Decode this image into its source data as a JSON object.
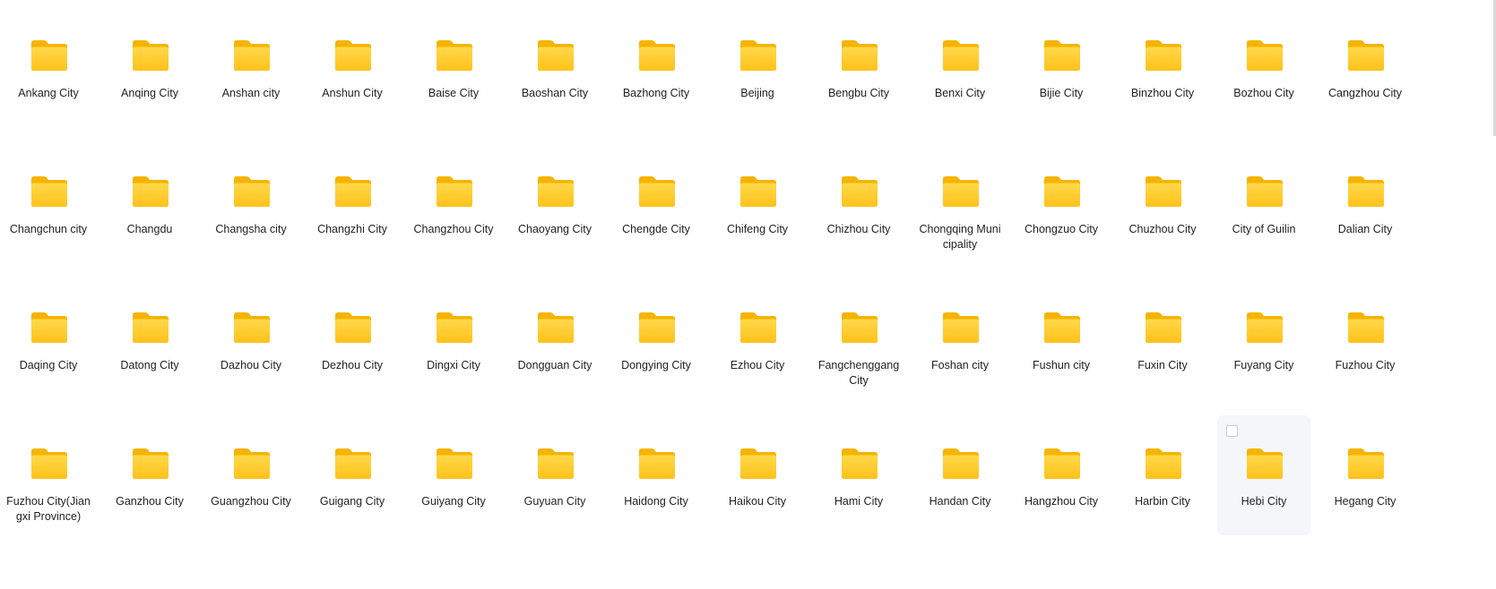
{
  "folders": [
    {
      "name": "Ankang City"
    },
    {
      "name": "Anqing City"
    },
    {
      "name": "Anshan city"
    },
    {
      "name": "Anshun City"
    },
    {
      "name": "Baise City"
    },
    {
      "name": "Baoshan City"
    },
    {
      "name": "Bazhong City"
    },
    {
      "name": "Beijing"
    },
    {
      "name": "Bengbu City"
    },
    {
      "name": "Benxi City"
    },
    {
      "name": "Bijie City"
    },
    {
      "name": "Binzhou City"
    },
    {
      "name": "Bozhou City"
    },
    {
      "name": "Cangzhou City"
    },
    {
      "name": "Changchun city"
    },
    {
      "name": "Changdu"
    },
    {
      "name": "Changsha city"
    },
    {
      "name": "Changzhi City"
    },
    {
      "name": "Changzhou City"
    },
    {
      "name": "Chaoyang City"
    },
    {
      "name": "Chengde City"
    },
    {
      "name": "Chifeng City"
    },
    {
      "name": "Chizhou City"
    },
    {
      "name": "Chongqing Municipality"
    },
    {
      "name": "Chongzuo City"
    },
    {
      "name": "Chuzhou City"
    },
    {
      "name": "City of Guilin"
    },
    {
      "name": "Dalian City"
    },
    {
      "name": "Daqing City"
    },
    {
      "name": "Datong City"
    },
    {
      "name": "Dazhou City"
    },
    {
      "name": "Dezhou City"
    },
    {
      "name": "Dingxi City"
    },
    {
      "name": "Dongguan City"
    },
    {
      "name": "Dongying City"
    },
    {
      "name": "Ezhou City"
    },
    {
      "name": "Fangchenggang City"
    },
    {
      "name": "Foshan city"
    },
    {
      "name": "Fushun city"
    },
    {
      "name": "Fuxin City"
    },
    {
      "name": "Fuyang City"
    },
    {
      "name": "Fuzhou City"
    },
    {
      "name": "Fuzhou City(Jiangxi Province)"
    },
    {
      "name": "Ganzhou City"
    },
    {
      "name": "Guangzhou City"
    },
    {
      "name": "Guigang City"
    },
    {
      "name": "Guiyang City"
    },
    {
      "name": "Guyuan City"
    },
    {
      "name": "Haidong City"
    },
    {
      "name": "Haikou City"
    },
    {
      "name": "Hami City"
    },
    {
      "name": "Handan City"
    },
    {
      "name": "Hangzhou City"
    },
    {
      "name": "Harbin City"
    },
    {
      "name": "Hebi City",
      "hovered": true
    },
    {
      "name": "Hegang City"
    }
  ],
  "colors": {
    "folder_back": "#f5b400",
    "folder_front_top": "#ffd84a",
    "folder_front_bottom": "#ffc21a",
    "hover_bg": "#f5f6fa"
  },
  "icon": "folder-icon"
}
